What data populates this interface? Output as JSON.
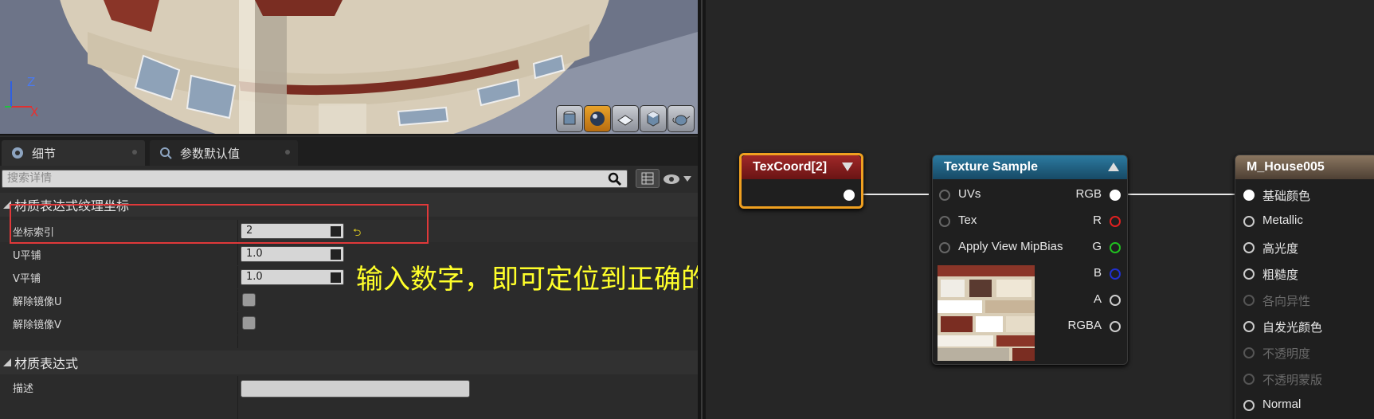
{
  "viewport": {
    "axis_z": "Z",
    "axis_x": "X",
    "preview_buttons": [
      "cylinder-icon",
      "sphere-icon",
      "plane-icon",
      "cube-icon",
      "teapot-icon"
    ],
    "active_preview": "sphere-icon"
  },
  "tabs": [
    {
      "label": "细节",
      "icon": "details-icon"
    },
    {
      "label": "参数默认值",
      "icon": "parameter-icon"
    }
  ],
  "search": {
    "placeholder": "搜索详情"
  },
  "sections": {
    "texcoord_title": "材质表达式纹理坐标",
    "expression_title": "材质表达式"
  },
  "properties": {
    "coord_index": {
      "label": "坐标索引",
      "value": "2"
    },
    "u_tiling": {
      "label": "U平铺",
      "value": "1.0"
    },
    "v_tiling": {
      "label": "V平铺",
      "value": "1.0"
    },
    "unmirror_u": {
      "label": "解除镜像U",
      "checked": false
    },
    "unmirror_v": {
      "label": "解除镜像V",
      "checked": false
    },
    "description": {
      "label": "描述",
      "value": ""
    }
  },
  "annotation": "输入数字，即可定位到正确的UV通道",
  "nodes": {
    "texcoord": {
      "title": "TexCoord[2]",
      "color": "#8b1d1d"
    },
    "texture_sample": {
      "title": "Texture Sample",
      "color": "#1f5b7c",
      "inputs": [
        "UVs",
        "Tex",
        "Apply View MipBias"
      ],
      "outputs": [
        {
          "label": "RGB",
          "color": "#ffffff"
        },
        {
          "label": "R",
          "color": "#e02020"
        },
        {
          "label": "G",
          "color": "#20c020"
        },
        {
          "label": "B",
          "color": "#2030d0"
        },
        {
          "label": "A",
          "color": "#cccccc"
        },
        {
          "label": "RGBA",
          "color": "#cccccc"
        }
      ]
    },
    "material": {
      "title": "M_House005",
      "color": "#6a5a48",
      "inputs": [
        {
          "label": "基础颜色",
          "enabled": true
        },
        {
          "label": "Metallic",
          "enabled": true
        },
        {
          "label": "高光度",
          "enabled": true
        },
        {
          "label": "粗糙度",
          "enabled": true
        },
        {
          "label": "各向异性",
          "enabled": false
        },
        {
          "label": "自发光颜色",
          "enabled": true
        },
        {
          "label": "不透明度",
          "enabled": false
        },
        {
          "label": "不透明蒙版",
          "enabled": false
        },
        {
          "label": "Normal",
          "enabled": true
        }
      ]
    }
  }
}
